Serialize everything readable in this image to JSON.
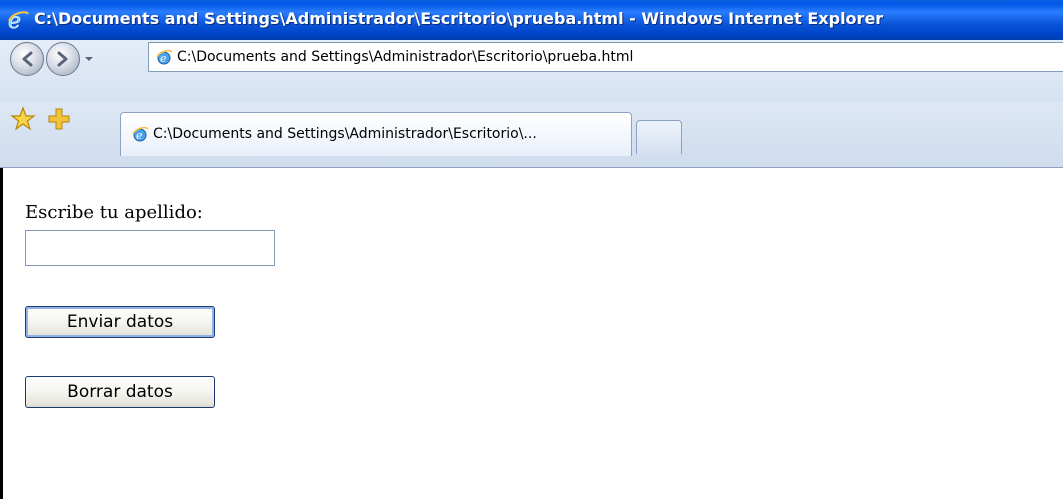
{
  "window": {
    "title": "C:\\Documents and Settings\\Administrador\\Escritorio\\prueba.html - Windows Internet Explorer"
  },
  "address_bar": {
    "url": "C:\\Documents and Settings\\Administrador\\Escritorio\\prueba.html",
    "icons": [
      "back-icon",
      "forward-icon",
      "recent-pages-dropdown-icon",
      "ie-page-icon"
    ]
  },
  "tabs": {
    "items": [
      {
        "label": "C:\\Documents and Settings\\Administrador\\Escritorio\\...",
        "icon": "ie-page-icon",
        "active": true
      }
    ],
    "favorites_icons": [
      "favorites-star-icon",
      "add-favorite-icon"
    ]
  },
  "page": {
    "label": "Escribe tu apellido:",
    "input_value": "",
    "submit_button": "Enviar datos",
    "reset_button": "Borrar datos"
  },
  "colors": {
    "titlebar_blue": "#0058e6",
    "title_text": "#ffffff",
    "toolbar_bg": "#d6e2f2",
    "input_border": "#7f9db9",
    "button_border": "#1c3a70",
    "focus_ring": "#8fb1ea"
  }
}
